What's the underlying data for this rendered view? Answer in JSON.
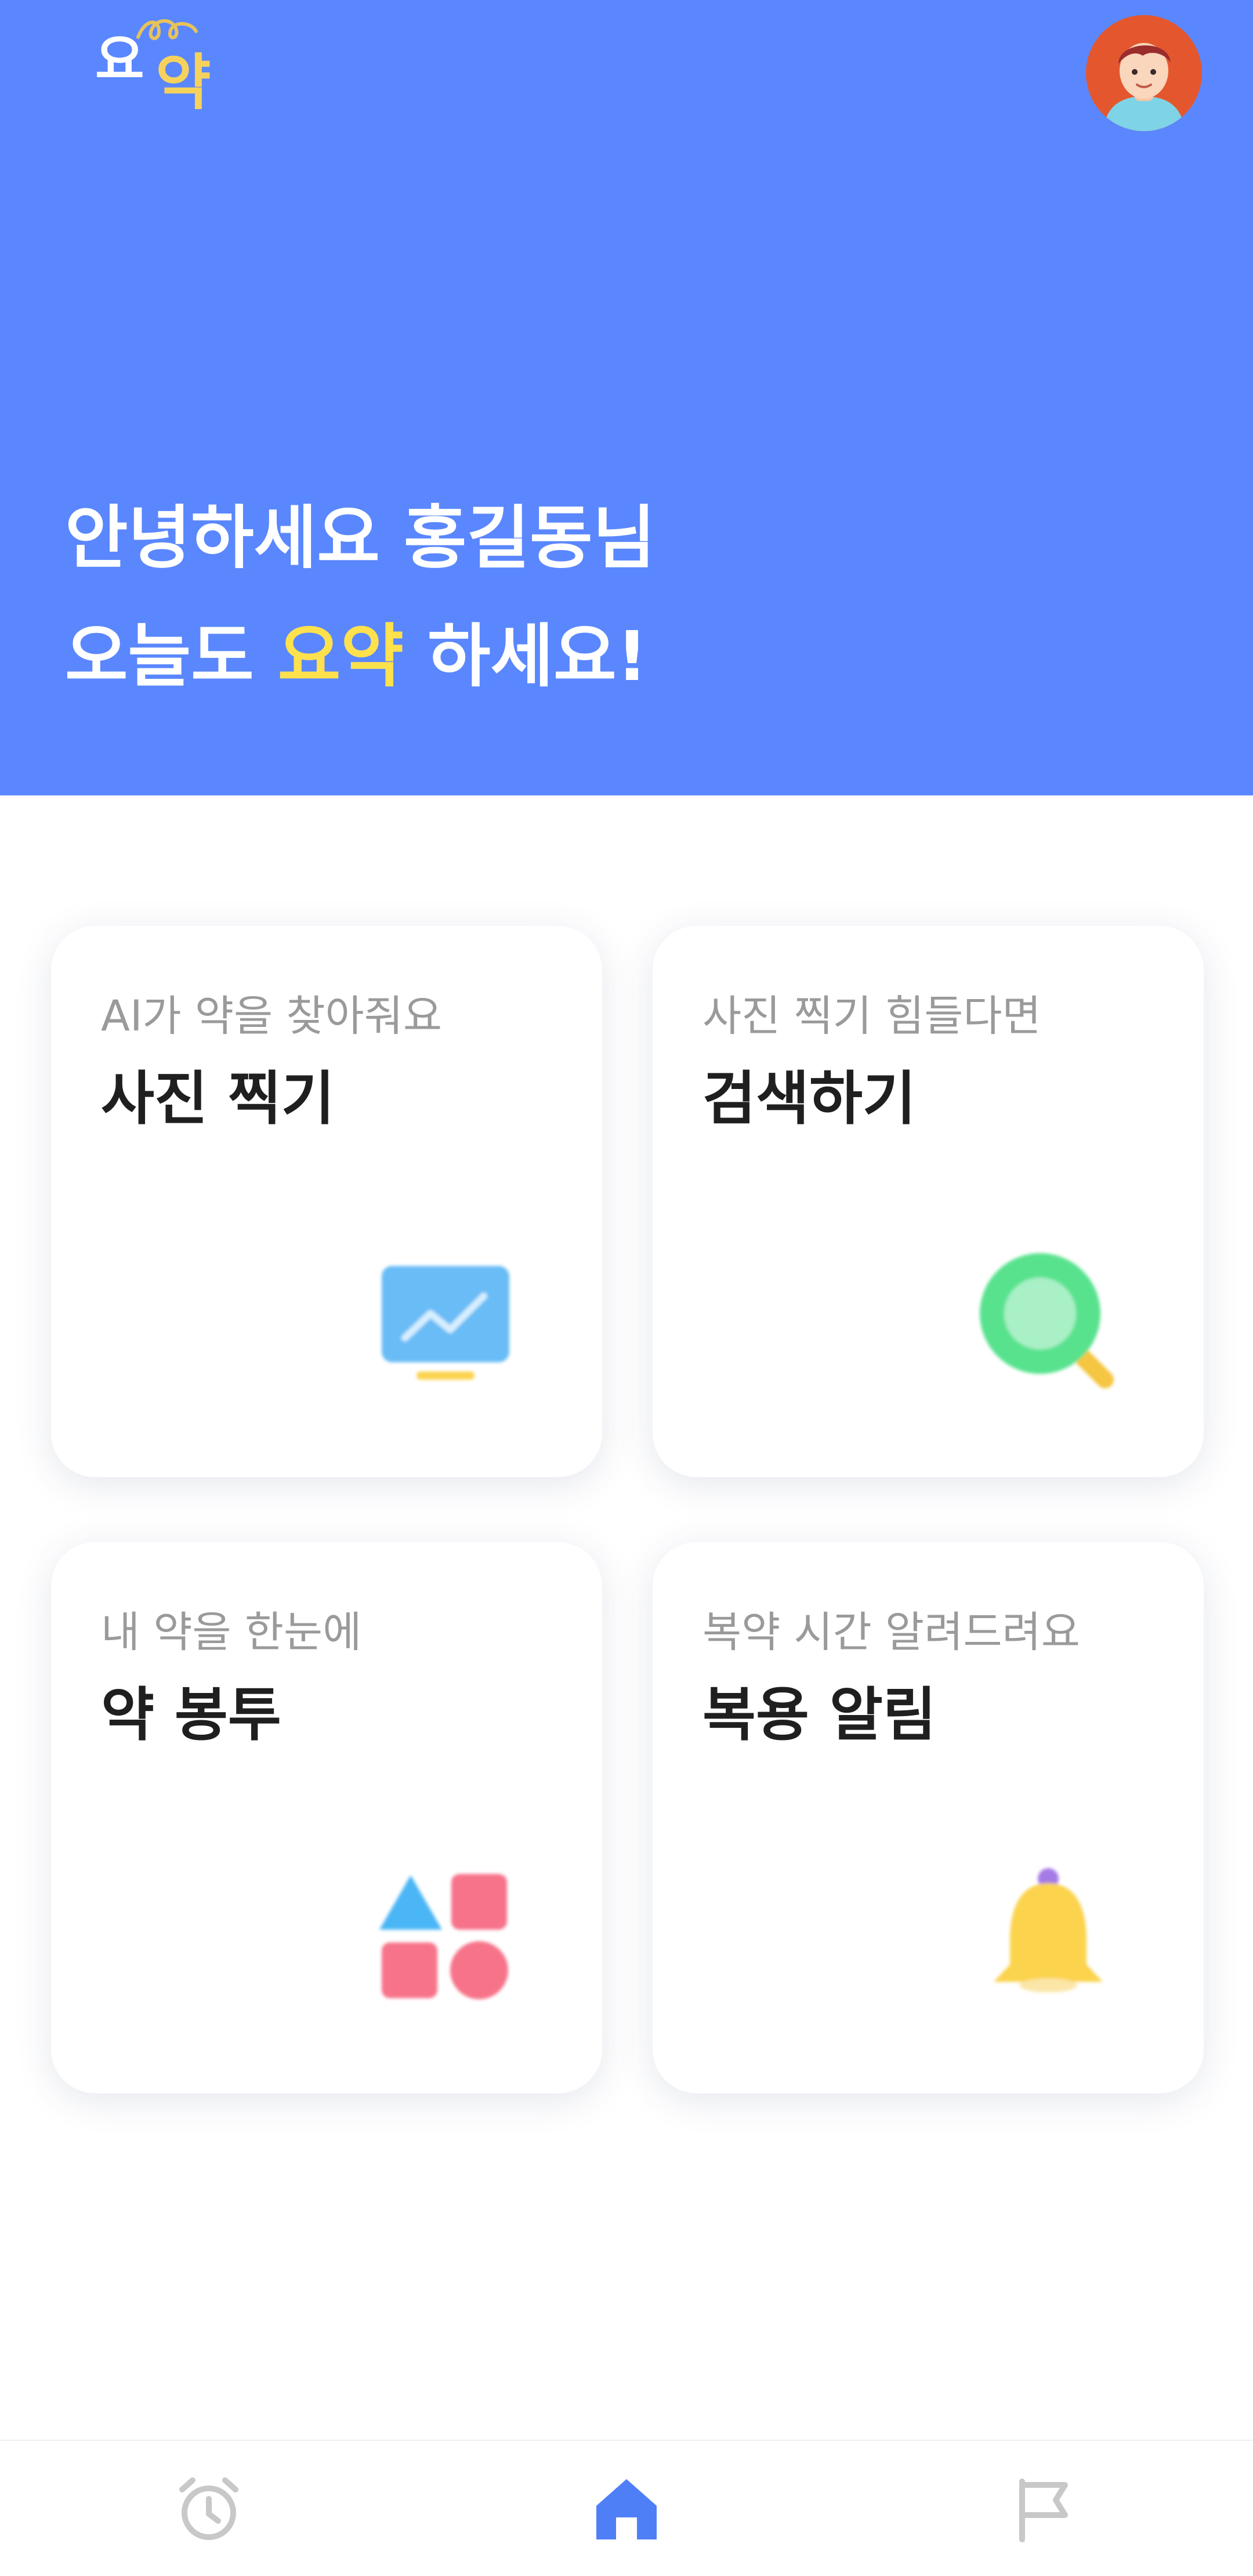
{
  "header": {
    "logo": {
      "char_a": "요",
      "char_b": "약"
    },
    "greeting_line1": "안녕하세요 홍길동님",
    "greeting_line2_prefix": "오늘도 ",
    "greeting_line2_highlight": "요약",
    "greeting_line2_suffix": " 하세요!",
    "colors": {
      "background": "#5a87fe",
      "highlight": "#ffe14d"
    }
  },
  "cards": [
    {
      "subtitle": "AI가 약을 찾아줘요",
      "title": "사진 찍기",
      "icon": "monitor-chart-icon"
    },
    {
      "subtitle": "사진 찍기 힘들다면",
      "title": "검색하기",
      "icon": "magnifier-icon"
    },
    {
      "subtitle": "내 약을 한눈에",
      "title": "약 봉투",
      "icon": "shapes-icon"
    },
    {
      "subtitle": "복약 시간 알려드려요",
      "title": "복용 알림",
      "icon": "bell-icon"
    }
  ],
  "bottom_nav": {
    "items": [
      {
        "icon": "alarm-clock-icon",
        "active": false
      },
      {
        "icon": "home-icon",
        "active": true
      },
      {
        "icon": "flag-icon",
        "active": false
      }
    ],
    "colors": {
      "active": "#4f7ff7",
      "inactive": "#c8c8c8"
    }
  }
}
